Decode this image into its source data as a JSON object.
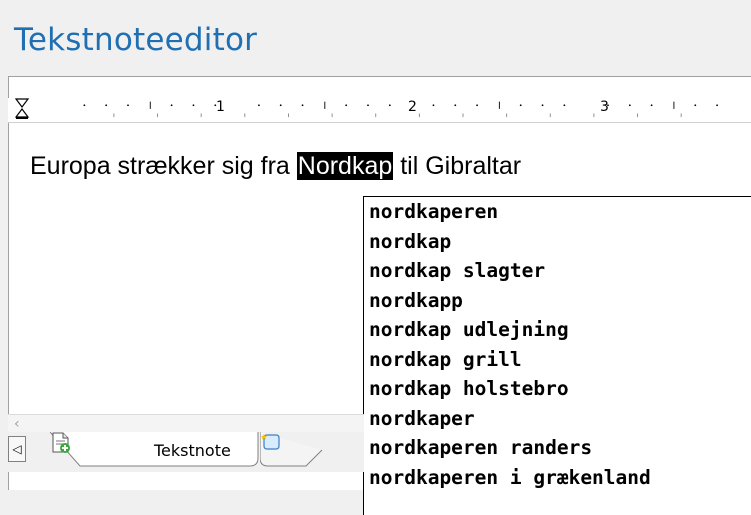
{
  "window": {
    "title": "Tekstnoteeditor"
  },
  "ruler": {
    "labels": [
      "1",
      "2",
      "3"
    ]
  },
  "editor": {
    "text_before": "Europa strækker sig fra ",
    "selected_word": "Nordkap",
    "text_after": " til Gibraltar"
  },
  "suggestions": {
    "items": [
      "nordkaperen",
      "nordkap",
      "nordkap slagter",
      "nordkapp",
      "nordkap udlejning",
      "nordkap grill",
      "nordkap holstebro",
      "nordkaper",
      "nordkaperen randers",
      "nordkaperen i grækenland"
    ]
  },
  "tabs": {
    "scroll_left_glyph": "◁",
    "active_label": "Tekstnote"
  },
  "colors": {
    "title": "#1f6fb2",
    "selection_bg": "#000000",
    "selection_fg": "#ffffff"
  }
}
